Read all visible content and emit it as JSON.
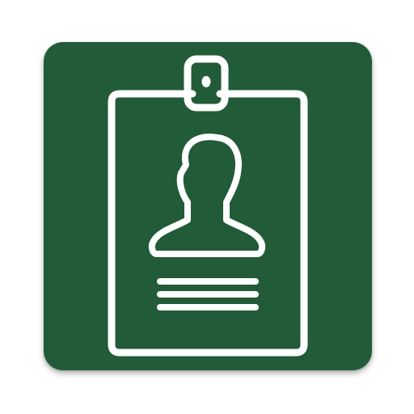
{
  "app_icon": {
    "icon": "id-badge-icon",
    "background_color": "#215B38",
    "foreground_color": "#FFFFFF"
  }
}
